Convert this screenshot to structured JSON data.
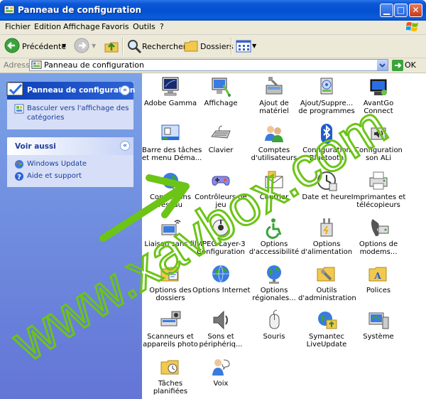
{
  "window": {
    "title": "Panneau de configuration"
  },
  "menubar": {
    "items": [
      "Fichier",
      "Edition",
      "Affichage",
      "Favoris",
      "Outils",
      "?"
    ]
  },
  "toolbar": {
    "back_label": "Précédente",
    "search_label": "Rechercher",
    "folders_label": "Dossiers"
  },
  "address": {
    "label": "Adresse",
    "value": "Panneau de configuration",
    "go_label": "OK"
  },
  "left_pane": {
    "control_panel": {
      "title": "Panneau de configuration",
      "link": [
        "Basculer vers l'affichage des",
        "catégories"
      ]
    },
    "see_also": {
      "title": "Voir aussi",
      "links": [
        "Windows Update",
        "Aide et support"
      ]
    }
  },
  "items": [
    {
      "name": "adobe-gamma",
      "icon": "monitor-icon",
      "lines": [
        "Adobe Gamma"
      ]
    },
    {
      "name": "affichage",
      "icon": "display-icon",
      "lines": [
        "Affichage"
      ]
    },
    {
      "name": "ajout-materiel",
      "icon": "hardware-icon",
      "lines": [
        "Ajout de",
        "matériel"
      ]
    },
    {
      "name": "ajout-suppression",
      "icon": "add-remove-icon",
      "lines": [
        "Ajout/Suppre...",
        "de programmes"
      ]
    },
    {
      "name": "avantgo",
      "icon": "avantgo-icon",
      "lines": [
        "AvantGo",
        "Connect"
      ]
    },
    {
      "name": "barre-taches",
      "icon": "taskbar-icon",
      "lines": [
        "Barre des tâches",
        "et menu Déma..."
      ]
    },
    {
      "name": "clavier",
      "icon": "keyboard-icon",
      "lines": [
        "Clavier"
      ]
    },
    {
      "name": "comptes",
      "icon": "users-icon",
      "lines": [
        "Comptes",
        "d'utilisateurs"
      ]
    },
    {
      "name": "bluetooth",
      "icon": "bluetooth-icon",
      "lines": [
        "Configuration",
        "Bluetooth"
      ]
    },
    {
      "name": "config-son",
      "icon": "sound-config-icon",
      "lines": [
        "Configuration",
        "son ALi"
      ]
    },
    {
      "name": "connexions-reseau",
      "icon": "network-icon",
      "lines": [
        "Connexions",
        "réseau"
      ]
    },
    {
      "name": "controleurs-jeu",
      "icon": "gamepad-icon",
      "lines": [
        "Contrôleurs de",
        "jeu"
      ]
    },
    {
      "name": "courrier",
      "icon": "mail-icon",
      "lines": [
        "Courrier"
      ]
    },
    {
      "name": "date-heure",
      "icon": "clock-icon",
      "lines": [
        "Date et heure"
      ]
    },
    {
      "name": "imprimantes",
      "icon": "printer-icon",
      "lines": [
        "Imprimantes et",
        "télécopieurs"
      ]
    },
    {
      "name": "liaison",
      "icon": "wireless-link-icon",
      "lines": [
        "Liaison sans fil"
      ]
    },
    {
      "name": "mpeg",
      "icon": "mpeg-icon",
      "lines": [
        "MPEG Layer-3",
        "Configuration"
      ]
    },
    {
      "name": "accessibilite",
      "icon": "accessibility-icon",
      "lines": [
        "Options",
        "d'accessibilité"
      ]
    },
    {
      "name": "alimentation",
      "icon": "power-icon",
      "lines": [
        "Options",
        "d'alimentation"
      ]
    },
    {
      "name": "modems",
      "icon": "phone-modem-icon",
      "lines": [
        "Options de",
        "modems..."
      ]
    },
    {
      "name": "options-dossiers",
      "icon": "folder-options-icon",
      "lines": [
        "Options des",
        "dossiers"
      ]
    },
    {
      "name": "options-internet",
      "icon": "internet-globe-icon",
      "lines": [
        "Options Internet"
      ]
    },
    {
      "name": "options-regionales",
      "icon": "regional-globe-icon",
      "lines": [
        "Options",
        "régionales..."
      ]
    },
    {
      "name": "outils-admin",
      "icon": "admin-tools-icon",
      "lines": [
        "Outils",
        "d'administration"
      ]
    },
    {
      "name": "polices",
      "icon": "fonts-folder-icon",
      "lines": [
        "Polices"
      ]
    },
    {
      "name": "scanneurs",
      "icon": "scanner-icon",
      "lines": [
        "Scanneurs et",
        "appareils photo"
      ]
    },
    {
      "name": "sons",
      "icon": "speaker-icon",
      "lines": [
        "Sons et",
        "périphériq..."
      ]
    },
    {
      "name": "souris",
      "icon": "mouse-icon",
      "lines": [
        "Souris"
      ]
    },
    {
      "name": "symantec",
      "icon": "liveupdate-icon",
      "lines": [
        "Symantec",
        "LiveUpdate"
      ]
    },
    {
      "name": "systeme",
      "icon": "system-icon",
      "lines": [
        "Système"
      ]
    },
    {
      "name": "taches-planifiees",
      "icon": "scheduled-tasks-icon",
      "lines": [
        "Tâches",
        "planifiées"
      ]
    },
    {
      "name": "voix",
      "icon": "speech-icon",
      "lines": [
        "Voix"
      ]
    }
  ],
  "watermark": {
    "text": "www.xavbox.com",
    "color": "#6cc417"
  },
  "colors": {
    "title_blue": "#0450d0",
    "pane_blue": "#6f8fdf",
    "link_blue": "#1c3d9c"
  }
}
